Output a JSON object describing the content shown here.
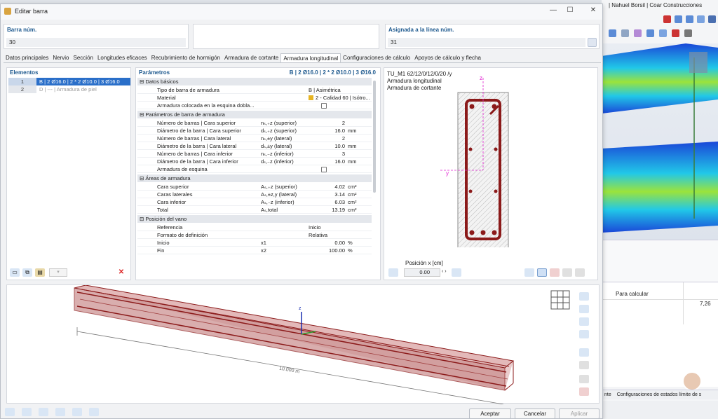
{
  "background_app": {
    "user_label": "| Nahuel Borsil | Coar Construcciones",
    "table_header": "Para calcular",
    "table_value": "7,26",
    "tab_partial": "nte",
    "tab_label": "Configuraciones de estados límite de s"
  },
  "dialog": {
    "title": "Editar barra",
    "minimize": "—",
    "maximize": "☐",
    "close": "✕",
    "bar_num_label": "Barra núm.",
    "bar_num_value": "30",
    "assigned_line_label": "Asignada a la línea núm.",
    "assigned_line_value": "31"
  },
  "tabs": [
    "Datos principales",
    "Nervio",
    "Sección",
    "Longitudes eficaces",
    "Recubrimiento de hormigón",
    "Armadura de cortante",
    "Armadura longitudinal",
    "Configuraciones de cálculo",
    "Apoyos de cálculo y flecha"
  ],
  "elements": {
    "header": "Elementos",
    "items": [
      {
        "num": "1",
        "label": "B | 2 Ø16.0 | 2 * 2 Ø10.0 | 3 Ø16.0",
        "selected": true
      },
      {
        "num": "2",
        "label": "D | --- | Armadura de piel",
        "selected": false
      }
    ]
  },
  "parameters": {
    "header": "Parámetros",
    "summary": "B | 2 Ø16.0 | 2 * 2 Ø10.0 | 3 Ø16.0",
    "sections": [
      {
        "title": "Datos básicos",
        "rows": [
          {
            "name": "Tipo de barra de armadura",
            "symbol": "",
            "value": "B | Asimétrica",
            "unit": ""
          },
          {
            "name": "Material",
            "symbol": "",
            "value": "2 - Calidad 60 | Isótro...",
            "unit": "",
            "swatch": true
          },
          {
            "name": "Armadura colocada en la esquina dobla...",
            "symbol": "",
            "value": "",
            "unit": "",
            "checkbox": true
          }
        ]
      },
      {
        "title": "Parámetros de barra de armadura",
        "rows": [
          {
            "name": "Número de barras | Cara superior",
            "symbol": "nₛ,₊z (superior)",
            "value": "2",
            "unit": ""
          },
          {
            "name": "Diámetro de la barra | Cara superior",
            "symbol": "dₛ,₊z (superior)",
            "value": "16.0",
            "unit": "mm"
          },
          {
            "name": "Número de barras | Cara lateral",
            "symbol": "nₛ,±y (lateral)",
            "value": "2",
            "unit": ""
          },
          {
            "name": "Diámetro de la barra | Cara lateral",
            "symbol": "dₛ,±y (lateral)",
            "value": "10.0",
            "unit": "mm"
          },
          {
            "name": "Número de barras | Cara inferior",
            "symbol": "nₛ,₋z (inferior)",
            "value": "3",
            "unit": ""
          },
          {
            "name": "Diámetro de la barra | Cara inferior",
            "symbol": "dₛ,₋z (inferior)",
            "value": "16.0",
            "unit": "mm"
          },
          {
            "name": "Armadura de esquina",
            "symbol": "",
            "value": "",
            "unit": "",
            "checkbox": true
          }
        ]
      },
      {
        "title": "Áreas de armadura",
        "rows": [
          {
            "name": "Cara superior",
            "symbol": "Aₛ,₊z (superior)",
            "value": "4.02",
            "unit": "cm²"
          },
          {
            "name": "Caras laterales",
            "symbol": "Aₛ,±z,y (lateral)",
            "value": "3.14",
            "unit": "cm²"
          },
          {
            "name": "Cara inferior",
            "symbol": "Aₛ,₋z (inferior)",
            "value": "6.03",
            "unit": "cm²"
          },
          {
            "name": "Total",
            "symbol": "Aₛ,total",
            "value": "13.19",
            "unit": "cm²"
          }
        ]
      },
      {
        "title": "Posición del vano",
        "rows": [
          {
            "name": "Referencia",
            "symbol": "",
            "value": "Inicio",
            "unit": ""
          },
          {
            "name": "Formato de definición",
            "symbol": "",
            "value": "Relativa",
            "unit": ""
          },
          {
            "name": "Inicio",
            "symbol": "x1",
            "value": "0.00",
            "unit": "%"
          },
          {
            "name": "Fin",
            "symbol": "x2",
            "value": "100.00",
            "unit": "%"
          }
        ]
      }
    ]
  },
  "section_view": {
    "line1": "TU_M1 62/12/0/12/0/20 /y",
    "line2": "Armadura longitudinal",
    "line3": "Armadura de cortante",
    "axis_z": "z",
    "axis_y": "y",
    "position_label": "Posición x [cm]",
    "position_value": "0.00"
  },
  "model_view": {
    "length_label": "10.000 m",
    "axis_z": "z"
  },
  "buttons": {
    "accept": "Aceptar",
    "cancel": "Cancelar",
    "apply": "Aplicar"
  },
  "colors": {
    "accent": "#1f5a8f",
    "selection": "#2a6fc9",
    "rebar": "#8b1a1a",
    "beam": "#c98d8d"
  }
}
